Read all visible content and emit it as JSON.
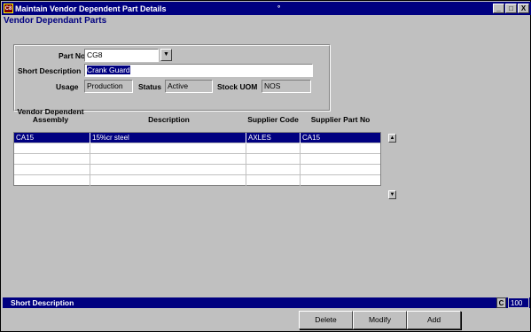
{
  "window": {
    "app_icon_text": "C8",
    "title": "Maintain Vendor Dependent Part Details",
    "title_mark": "°",
    "minimize": "_",
    "maximize": "□",
    "close": "X"
  },
  "form": {
    "heading": "Vendor Dependant Parts",
    "part_no_label": "Part No",
    "part_no_value": "CG8",
    "part_no_dropdown": "▼",
    "short_desc_label": "Short Description",
    "short_desc_value": "Crank Guard",
    "usage_label": "Usage",
    "usage_value": "Production",
    "status_label": "Status",
    "status_value": "Active",
    "stock_uom_label": "Stock UOM",
    "stock_uom_value": "NOS"
  },
  "grid": {
    "headers": [
      "Vendor Dependent",
      "Assembly",
      "Description",
      "Supplier Code",
      "Supplier Part No"
    ],
    "rows": [
      [
        "CA15",
        "15%cr steel",
        "AXLES",
        "CA15"
      ],
      [
        "",
        "",
        "",
        ""
      ],
      [
        "",
        "",
        "",
        ""
      ],
      [
        "",
        "",
        "",
        ""
      ],
      [
        "",
        "",
        "",
        ""
      ]
    ],
    "scroll_up": "▲",
    "scroll_down": "▼"
  },
  "statusbar": {
    "text": "Short Description",
    "mode": "C",
    "zoom": "100"
  },
  "buttons": {
    "delete": "Delete",
    "modify": "Modify",
    "add": "Add"
  },
  "colors": {
    "title_bar": "#000080",
    "face": "#c0c0c0",
    "heading": "#000080",
    "selection": "#000080"
  },
  "icons": [
    "app-icon",
    "dropdown-arrow-icon",
    "scroll-up-icon",
    "scroll-down-icon"
  ]
}
